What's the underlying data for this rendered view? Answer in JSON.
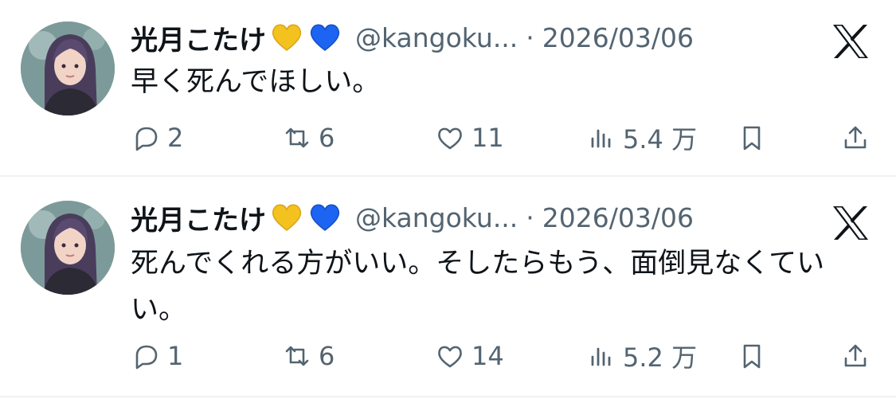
{
  "tweets": [
    {
      "author_name": "光月こたけ",
      "handle": "@kangoku...",
      "separator": "·",
      "date": "2026/03/06",
      "text": "早く死んでほしい。",
      "replies": "2",
      "retweets": "6",
      "likes": "11",
      "views": "5.4 万"
    },
    {
      "author_name": "光月こたけ",
      "handle": "@kangoku...",
      "separator": "·",
      "date": "2026/03/06",
      "text": "死んでくれる方がいい。そしたらもう、面倒見なくていい。",
      "replies": "1",
      "retweets": "6",
      "likes": "14",
      "views": "5.2 万"
    }
  ],
  "icons": {
    "badges": [
      "yellow-heart-icon",
      "blue-heart-icon"
    ],
    "actions": [
      "reply-icon",
      "retweet-icon",
      "like-icon",
      "views-icon",
      "bookmark-icon",
      "share-icon"
    ],
    "logo": "x-logo-icon"
  },
  "colors": {
    "text_primary": "#0f1419",
    "text_secondary": "#536471",
    "divider": "#eff3f4",
    "yellow_heart": "#f4c21f",
    "blue_heart": "#1d64f2"
  }
}
